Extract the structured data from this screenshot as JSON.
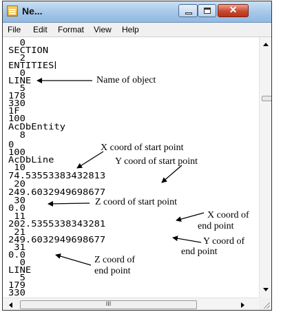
{
  "window": {
    "title": "Ne..."
  },
  "menu": [
    "File",
    "Edit",
    "Format",
    "View",
    "Help"
  ],
  "lines": [
    "  0",
    "SECTION",
    "  2",
    "ENTITIES",
    "  0",
    "LINE",
    "  5",
    "178",
    "330",
    "1F",
    "100",
    "AcDbEntity",
    "  8",
    "0",
    "100",
    "AcDbLine",
    " 10",
    "74.53553383432813",
    " 20",
    "249.6032949698677",
    " 30",
    "0.0",
    " 11",
    "202.5355338343281",
    " 21",
    "249.6032949698677",
    " 31",
    "0.0",
    "  0",
    "LINE",
    "  5",
    "179",
    "330"
  ],
  "annotations": {
    "name_of_object": "Name of object",
    "x_start": "X coord of start point",
    "y_start": "Y coord of start point",
    "z_start": "Z coord of start point",
    "x_end_1": "X coord of",
    "x_end_2": "end point",
    "y_end_1": "Y coord of",
    "y_end_2": "end point",
    "z_end_1": "Z coord of",
    "z_end_2": "end point"
  },
  "scrollbar": {
    "thumb_grip": "III"
  }
}
